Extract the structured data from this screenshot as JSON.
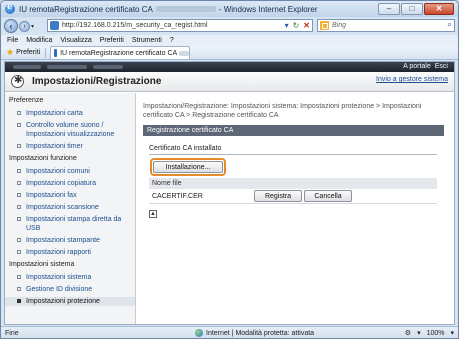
{
  "window": {
    "title_prefix": "IU remotaRegistrazione certificato CA",
    "title_suffix": "- Windows Internet Explorer",
    "minimize": "–",
    "maximize": "□",
    "close": "✕"
  },
  "address": {
    "url": "http://192.168.0.215/m_security_ca_regist.html",
    "refresh": "↻",
    "stop": "✕",
    "go": "▾"
  },
  "search": {
    "placeholder": "Bing",
    "go_glyph": "⌕"
  },
  "menu": {
    "items": [
      "File",
      "Modifica",
      "Visualizza",
      "Preferiti",
      "Strumenti",
      "?"
    ]
  },
  "favorites": {
    "label": "Preferiti",
    "tab_label": "IU remotaRegistrazione certificato CA"
  },
  "band": {
    "portal_link": "A portale",
    "exit_link": "Esci"
  },
  "header": {
    "title": "Impostazioni/Registrazione",
    "back_link": "Invio a gestore sistema"
  },
  "sidebar": {
    "sections": [
      {
        "heading": "Preferenze",
        "items": [
          {
            "label": "Impostazioni carta"
          },
          {
            "label": "Controllo volume suono / Impostazioni visualizzazione"
          },
          {
            "label": "Impostazioni timer"
          }
        ]
      },
      {
        "heading": "Impostazioni funzione",
        "items": [
          {
            "label": "Impostazioni comuni"
          },
          {
            "label": "Impostazioni copiatura"
          },
          {
            "label": "Impostazioni fax"
          },
          {
            "label": "Impostazioni scansione"
          },
          {
            "label": "Impostazioni stampa diretta da USB"
          },
          {
            "label": "Impostazioni stampante"
          },
          {
            "label": "Impostazioni rapporti"
          }
        ]
      },
      {
        "heading": "Impostazioni sistema",
        "items": [
          {
            "label": "Impostazioni sistema"
          },
          {
            "label": "Gestione ID divisione"
          },
          {
            "label": "Impostazioni protezione"
          }
        ]
      }
    ]
  },
  "main": {
    "breadcrumb": "Impostazioni/Registrazione: Impostazioni sistema: Impostazioni protezione > Impostazioni certificato CA > Registrazione certificato CA",
    "section_title": "Registrazione certificato CA",
    "box_title": "Certificato CA installato",
    "install_button": "Installazione...",
    "file_header": "Nome file",
    "file_name": "CACERTIF.CER",
    "register_button": "Registra",
    "cancel_button": "Cancella",
    "top_icon": "▲"
  },
  "status": {
    "left": "Fine",
    "zone": "Internet | Modalità protetta: attivata",
    "security": "⚙",
    "zoom": "100%",
    "zoom_dd": "▾"
  }
}
